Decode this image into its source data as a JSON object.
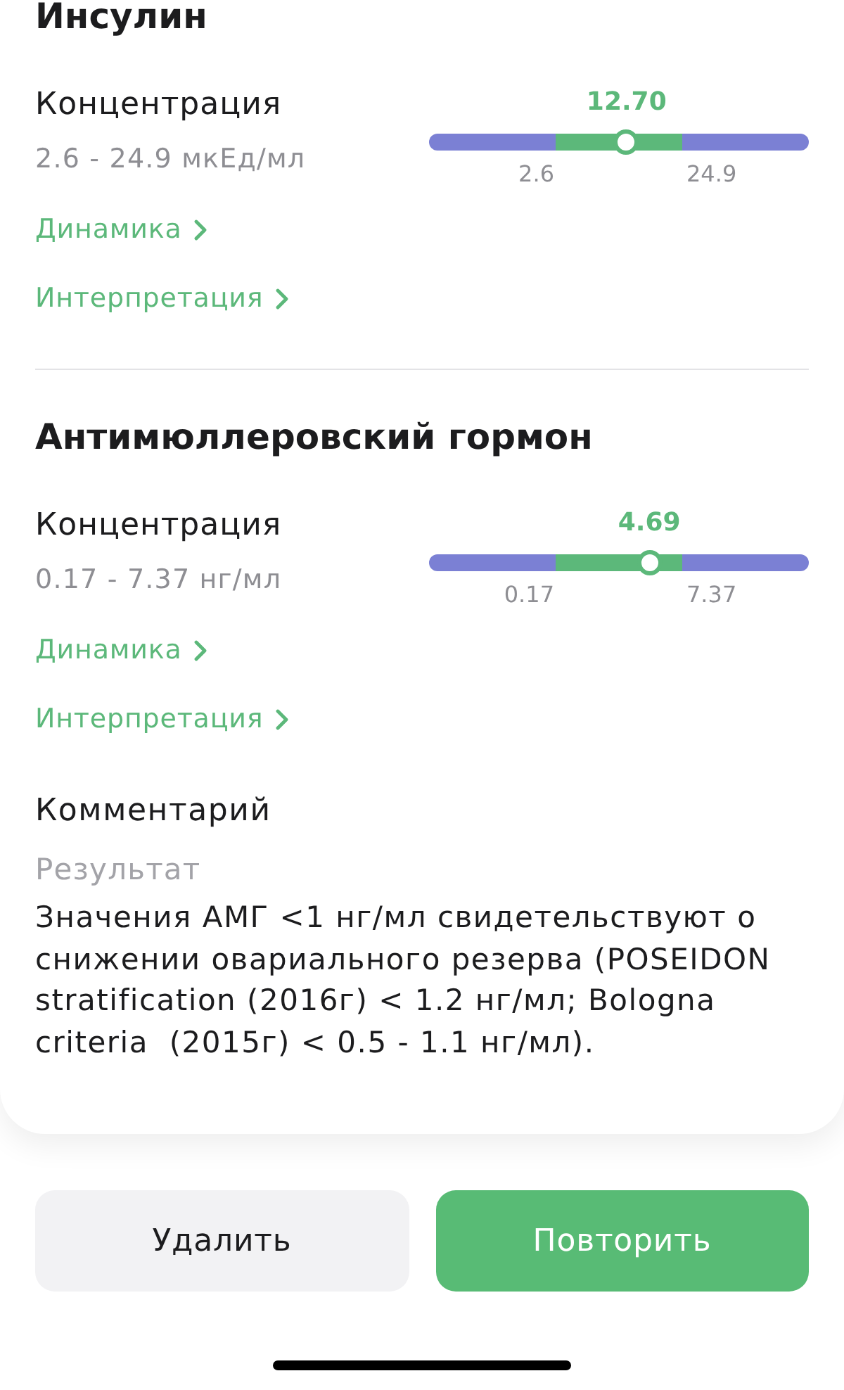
{
  "sections": [
    {
      "title": "Инсулин",
      "metric": {
        "label": "Концентрация",
        "range": "2.6 - 24.9 мкЕд/мл",
        "value": "12.70",
        "level": 0.52,
        "low": "2.6",
        "high": "24.9"
      },
      "links": [
        "Динамика",
        "Интерпретация"
      ]
    },
    {
      "title": "Антимюллеровский гормон",
      "metric": {
        "label": "Концентрация",
        "range": "0.17 - 7.37 нг/мл",
        "value": "4.69",
        "level": 0.58,
        "low": "0.17",
        "high": "7.37"
      },
      "links": [
        "Динамика",
        "Интерпретация"
      ]
    }
  ],
  "comment": {
    "title": "Комментарий",
    "subtitle": "Результат",
    "text": "Значения АМГ <1 нг/мл свидетельствуют о снижении овариального резерва (POSEIDON stratification (2016г) < 1.2 нг/мл; Bologna criteria  (2015г) < 0.5 - 1.1 нг/мл)."
  },
  "buttons": [
    {
      "label": "Удалить",
      "kind": "secondary"
    },
    {
      "label": "Повторить",
      "kind": "primary"
    }
  ]
}
